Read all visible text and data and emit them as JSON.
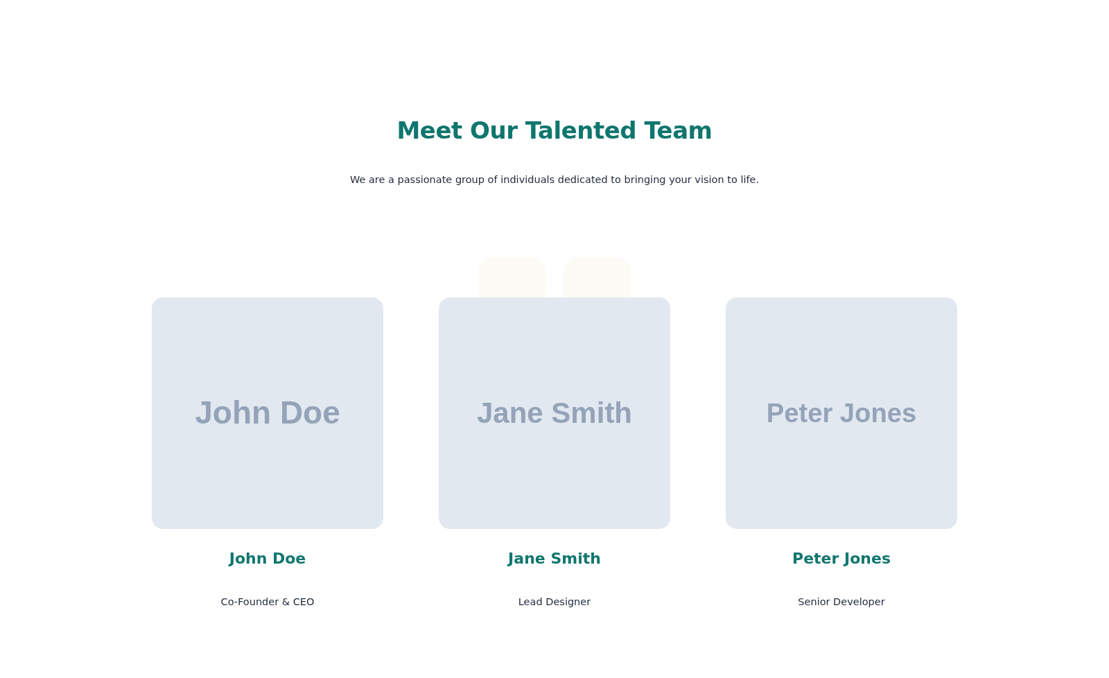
{
  "section": {
    "title": "Meet Our Talented Team",
    "subtitle": "We are a passionate group of individuals dedicated to bringing your vision to life."
  },
  "members": [
    {
      "photo_label": "John Doe",
      "name": "John Doe",
      "role": "Co-Founder & CEO"
    },
    {
      "photo_label": "Jane Smith",
      "name": "Jane Smith",
      "role": "Lead Designer"
    },
    {
      "photo_label": "Peter Jones",
      "name": "Peter Jones",
      "role": "Senior Developer"
    }
  ]
}
